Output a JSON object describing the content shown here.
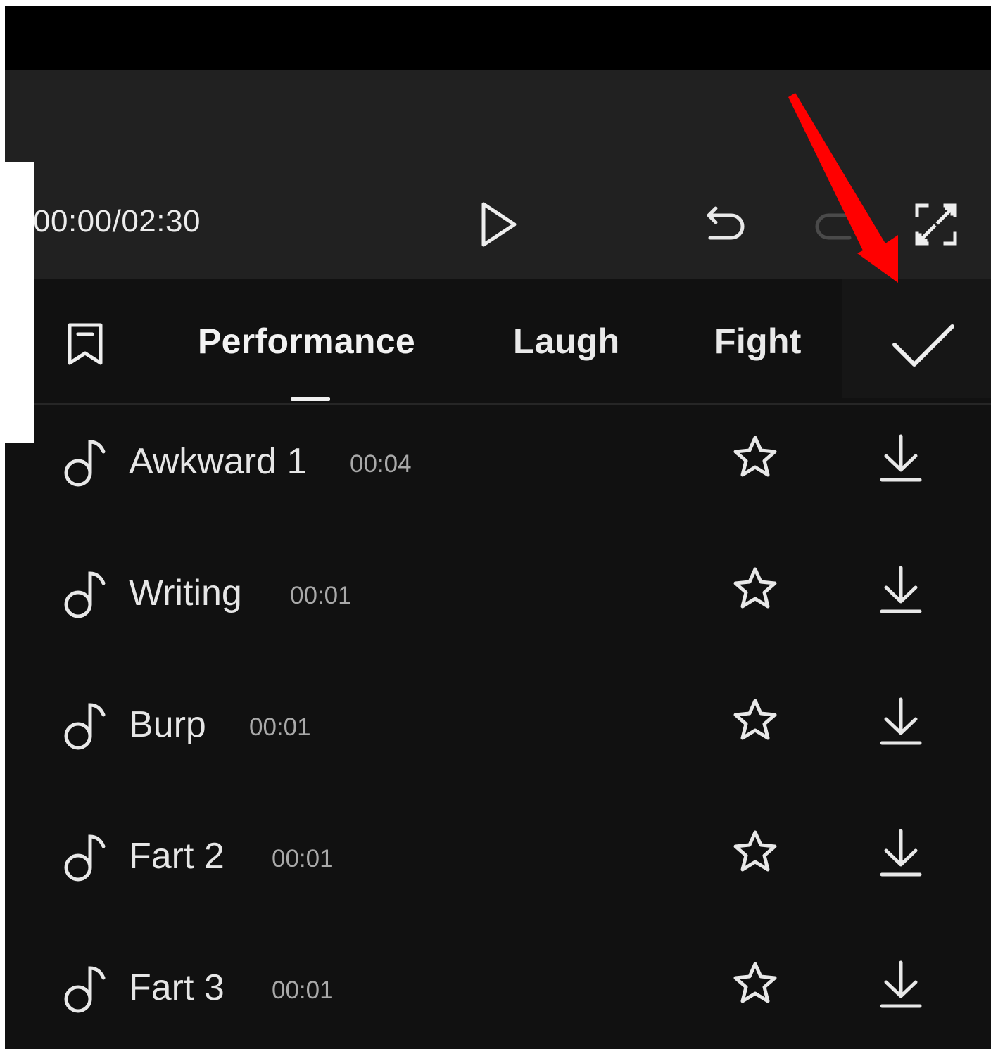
{
  "player": {
    "time": "00:00/02:30"
  },
  "tabs": [
    {
      "label": "Performance",
      "active": true
    },
    {
      "label": "Laugh",
      "active": false
    },
    {
      "label": "Fight",
      "active": false
    }
  ],
  "sounds": [
    {
      "name": "Awkward 1",
      "duration": "00:04"
    },
    {
      "name": "Writing",
      "duration": "00:01"
    },
    {
      "name": "Burp",
      "duration": "00:01"
    },
    {
      "name": "Fart 2",
      "duration": "00:01"
    },
    {
      "name": "Fart 3",
      "duration": "00:01"
    }
  ],
  "icons": {
    "play": "play-icon",
    "undo": "undo-icon",
    "redo": "redo-icon",
    "fullscreen": "fullscreen-icon",
    "bookmark": "bookmark-icon",
    "confirm": "checkmark-icon",
    "note": "music-note-icon",
    "favorite": "star-icon",
    "download": "download-icon"
  },
  "colors": {
    "panel_bg": "#111111",
    "preview_bg": "#212121",
    "text": "#e6e6e6",
    "annotation_arrow": "#ff0000"
  }
}
